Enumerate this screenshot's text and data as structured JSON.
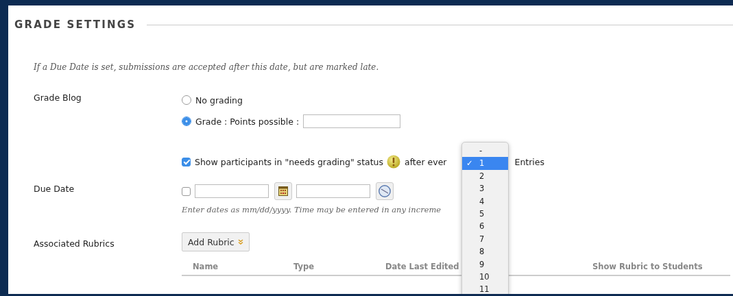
{
  "section": {
    "title": "GRADE SETTINGS",
    "note": "If a Due Date is set, submissions are accepted after this date, but are marked late."
  },
  "grade_blog": {
    "label": "Grade Blog",
    "options": [
      {
        "label": "No grading",
        "selected": false
      },
      {
        "label": "Grade : Points possible :",
        "selected": true
      }
    ],
    "needs_grading": {
      "checked": true,
      "label": "Show participants in \"needs grading\" status",
      "after": "after ever",
      "unit": "Entries"
    }
  },
  "entries_menu": {
    "items": [
      {
        "label": "-",
        "selected": false
      },
      {
        "label": "1",
        "selected": true
      },
      {
        "label": "2",
        "selected": false
      },
      {
        "label": "3",
        "selected": false
      },
      {
        "label": "4",
        "selected": false
      },
      {
        "label": "5",
        "selected": false
      },
      {
        "label": "6",
        "selected": false
      },
      {
        "label": "7",
        "selected": false
      },
      {
        "label": "8",
        "selected": false
      },
      {
        "label": "9",
        "selected": false
      },
      {
        "label": "10",
        "selected": false
      },
      {
        "label": "11",
        "selected": false
      }
    ],
    "check": "✓"
  },
  "due_date": {
    "label": "Due Date",
    "checked": false,
    "hint": "Enter dates as mm/dd/yyyy. Time may be entered in any increme"
  },
  "rubrics": {
    "label": "Associated Rubrics",
    "button": "Add Rubric",
    "columns": [
      "Name",
      "Type",
      "Date Last Edited",
      "Show Rubric to Students"
    ]
  }
}
